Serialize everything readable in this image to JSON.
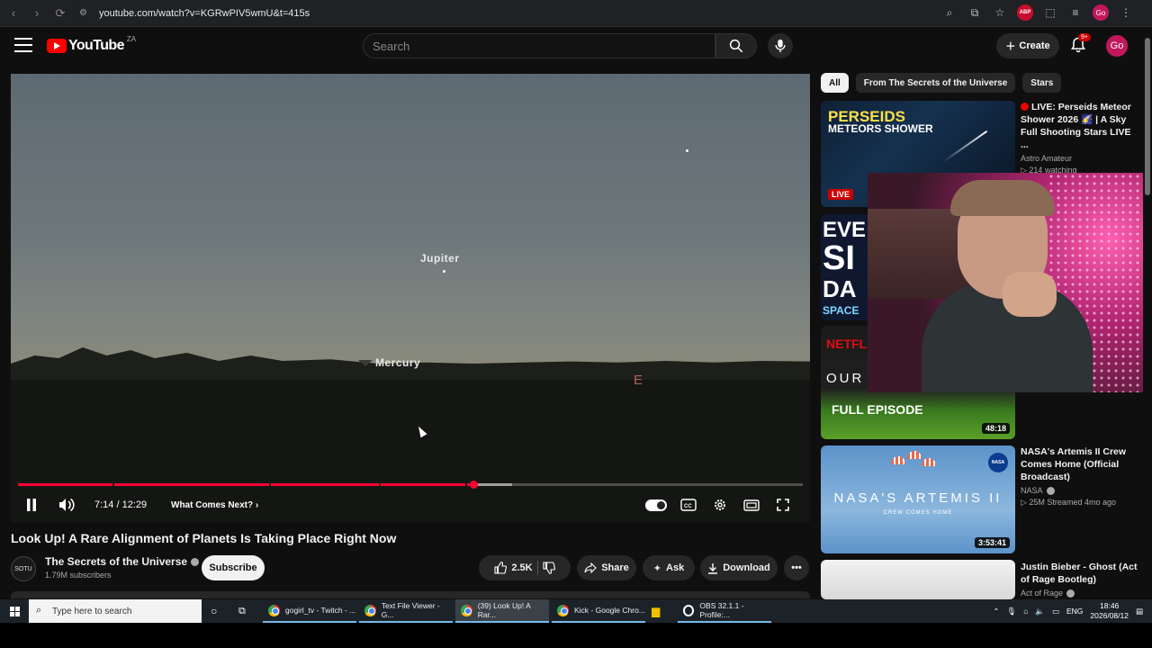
{
  "browser": {
    "url": "youtube.com/watch?v=KGRwPIV5wmU&t=415s",
    "profile_initials": "Go",
    "ext_label": "ABP"
  },
  "masthead": {
    "logo_text": "YouTube",
    "country_code": "ZA",
    "search_placeholder": "Search",
    "create_label": "Create",
    "notification_count": "9+",
    "avatar_initials": "Go"
  },
  "player": {
    "planet_jupiter": "Jupiter",
    "planet_mercury": "Mercury",
    "compass_east": "E",
    "time_display": "7:14 / 12:29",
    "chapter_label": "What Comes Next? ›",
    "progress_fraction": 0.58,
    "buffer_fraction": 0.63,
    "chapter_breaks": [
      0.12,
      0.32,
      0.46,
      0.57
    ]
  },
  "video": {
    "title": "Look Up! A Rare Alignment of Planets Is Taking Place Right Now",
    "channel_name": "The Secrets of the Universe",
    "channel_avatar_text": "SOTU",
    "subscribers": "1.79M subscribers",
    "subscribe_label": "Subscribe",
    "like_count": "2.5K",
    "share_label": "Share",
    "ask_label": "Ask",
    "download_label": "Download"
  },
  "chips": [
    {
      "label": "All",
      "active": true
    },
    {
      "label": "From The Secrets of the Universe",
      "active": false
    },
    {
      "label": "Stars",
      "active": false
    }
  ],
  "recommendations": [
    {
      "title": "LIVE: Perseids Meteor Shower 2026 🌠 | A Sky Full Shooting Stars LIVE ...",
      "channel": "Astro Amateur",
      "meta": "▷ 214 watching",
      "thumb_title": "PERSEIDS",
      "thumb_sub": "METEORS SHOWER",
      "badge": "LIVE"
    },
    {
      "thumb_lines": [
        "EVE",
        "SI",
        "DA",
        "SPACE"
      ]
    },
    {
      "thumb_brand": "NETFLIX",
      "thumb_title": "OUR",
      "thumb_sub": "FULL EPISODE",
      "duration": "48:18"
    },
    {
      "title": "NASA's Artemis II Crew Comes Home (Official Broadcast)",
      "channel": "NASA",
      "meta": "▷ 25M  Streamed 4mo ago",
      "thumb_title": "NASA'S ARTEMIS II",
      "thumb_sub": "CREW COMES HOME",
      "badge": "NASA",
      "duration": "3:53:41"
    },
    {
      "title": "Justin Bieber - Ghost (Act of Rage Bootleg)",
      "channel": "Act of Rage"
    }
  ],
  "taskbar": {
    "search_placeholder": "Type here to search",
    "apps": [
      {
        "label": "gogirl_tv - Twitch - ...",
        "active": false
      },
      {
        "label": "Text File Viewer - G...",
        "active": false
      },
      {
        "label": "(39) Look Up! A Rar...",
        "active": true
      },
      {
        "label": "Kick - Google Chro...",
        "active": false
      },
      {
        "label": "",
        "active": false
      },
      {
        "label": "OBS 32.1.1 - Profile:...",
        "active": false
      }
    ],
    "language": "ENG",
    "time": "18:46",
    "date": "2026/08/12"
  },
  "colors": {
    "brand_red": "#ff0000",
    "progress_red": "#ff0033",
    "background": "#0f0f0f"
  }
}
